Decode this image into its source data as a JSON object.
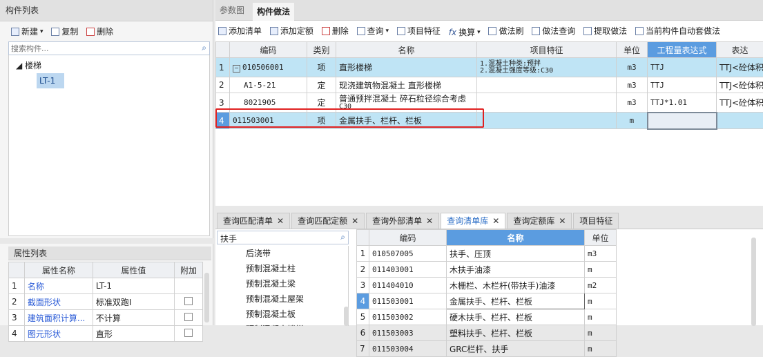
{
  "left": {
    "component_list_title": "构件列表",
    "toolbar": {
      "new": "新建",
      "copy": "复制",
      "delete": "删除"
    },
    "search_placeholder": "搜索构件...",
    "tree": {
      "root": "楼梯",
      "child": "LT-1"
    },
    "prop_title": "属性列表",
    "prop_headers": {
      "name": "属性名称",
      "value": "属性值",
      "attach": "附加"
    },
    "props": [
      {
        "no": "1",
        "name": "名称",
        "value": "LT-1"
      },
      {
        "no": "2",
        "name": "截面形状",
        "value": "标准双跑I"
      },
      {
        "no": "3",
        "name": "建筑面积计算...",
        "value": "不计算"
      },
      {
        "no": "4",
        "name": "图元形状",
        "value": "直形"
      }
    ]
  },
  "top_tabs": {
    "param": "参数图",
    "method": "构件做法"
  },
  "method_toolbar": {
    "add_list": "添加清单",
    "add_quota": "添加定额",
    "delete": "删除",
    "query": "查询",
    "feature": "项目特征",
    "convert": "换算",
    "brush": "做法刷",
    "method_query": "做法查询",
    "extract": "提取做法",
    "auto_apply": "当前构件自动套做法"
  },
  "grid_headers": {
    "code": "编码",
    "type": "类别",
    "name": "名称",
    "feature": "项目特征",
    "unit": "单位",
    "expr": "工程量表达式",
    "expr2": "表达"
  },
  "grid_rows": [
    {
      "no": "1",
      "code": "010506001",
      "type": "项",
      "name": "直形楼梯",
      "feature1": "1.混凝土种类:预拌",
      "feature2": "2.混凝土强度等级:C30",
      "unit": "m3",
      "expr": "TTJ",
      "expr2": "TTJ<砼体积"
    },
    {
      "no": "2",
      "code": "A1-5-21",
      "type": "定",
      "name": "现浇建筑物混凝土 直形楼梯",
      "feature1": "",
      "feature2": "",
      "unit": "m3",
      "expr": "TTJ",
      "expr2": "TTJ<砼体积"
    },
    {
      "no": "3",
      "code": "8021905",
      "type": "定",
      "name": "普通预拌混凝土 碎石粒径综合考虑",
      "name2": "C30",
      "feature1": "",
      "feature2": "",
      "unit": "m3",
      "expr": "TTJ*1.01",
      "expr2": "TTJ<砼体积"
    },
    {
      "no": "4",
      "code": "011503001",
      "type": "项",
      "name": "金属扶手、栏杆、栏板",
      "feature1": "",
      "feature2": "",
      "unit": "m",
      "expr": "",
      "expr2": ""
    }
  ],
  "bottom_tabs": [
    "查询匹配清单",
    "查询匹配定额",
    "查询外部清单",
    "查询清单库",
    "查询定额库",
    "项目特征"
  ],
  "bottom_search_value": "扶手",
  "bottom_tree": [
    "后浇带",
    "预制混凝土柱",
    "预制混凝土梁",
    "预制混凝土屋架",
    "预制混凝土板",
    "预制混凝土楼梯"
  ],
  "lib_headers": {
    "code": "编码",
    "name": "名称",
    "unit": "单位"
  },
  "lib_rows": [
    {
      "no": "1",
      "code": "010507005",
      "name": "扶手、压顶",
      "unit": "m3"
    },
    {
      "no": "2",
      "code": "011403001",
      "name": "木扶手油漆",
      "unit": "m"
    },
    {
      "no": "3",
      "code": "011404010",
      "name": "木栅栏、木栏杆(带扶手)油漆",
      "unit": "m2"
    },
    {
      "no": "4",
      "code": "011503001",
      "name": "金属扶手、栏杆、栏板",
      "unit": "m"
    },
    {
      "no": "5",
      "code": "011503002",
      "name": "硬木扶手、栏杆、栏板",
      "unit": "m"
    },
    {
      "no": "6",
      "code": "011503003",
      "name": "塑料扶手、栏杆、栏板",
      "unit": "m"
    },
    {
      "no": "7",
      "code": "011503004",
      "name": "GRC栏杆、扶手",
      "unit": "m"
    }
  ]
}
